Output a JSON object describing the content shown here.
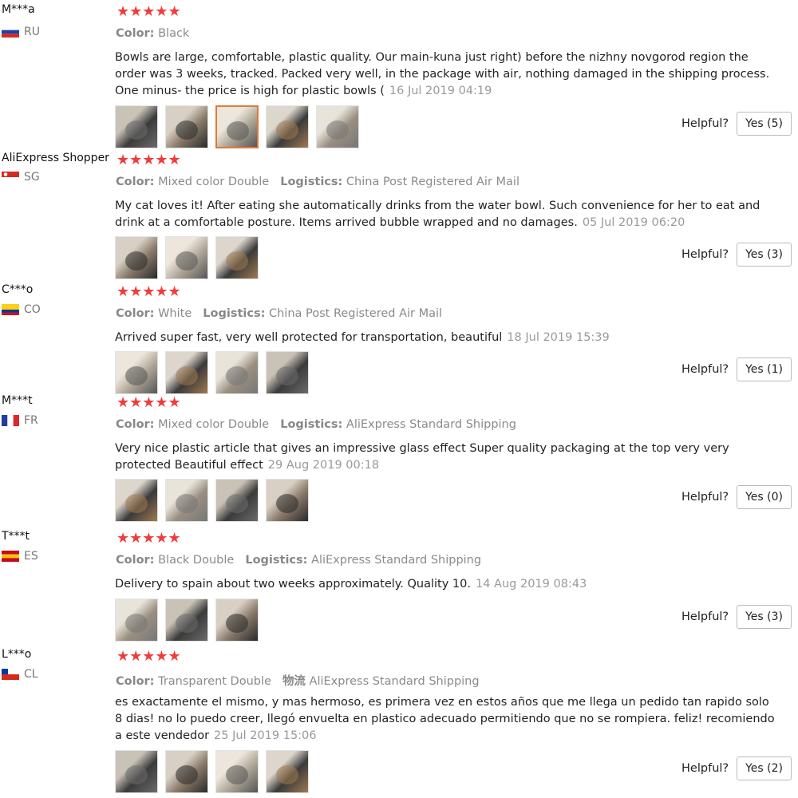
{
  "reviews": [
    {
      "user": "M***a",
      "country": "RU",
      "flag": [
        "#ffffff",
        "#1c3fa8",
        "#d52b1e"
      ],
      "stars": "★★★★★",
      "meta": [
        {
          "k": "Color:",
          "v": "Black"
        }
      ],
      "text": "Bowls are large, comfortable, plastic quality. Our main-kuna just right) before the nizhny novgorod region the order was 3 weeks, tracked. Packed very well, in the package with air, nothing damaged in the shipping process. One minus- the price is high for plastic bowls (",
      "date": "16 Jul 2019 04:19",
      "photos": [
        "photo-1",
        "photo-2",
        "photo-3",
        "photo-4",
        "photo-5"
      ],
      "helpful_label": "Helpful?",
      "yes_label": "Yes (5)"
    },
    {
      "user": "AliExpress Shopper",
      "country": "SG",
      "flag": [
        "#d52b1e",
        "#ffffff"
      ],
      "stars": "★★★★★",
      "meta": [
        {
          "k": "Color:",
          "v": "Mixed color Double"
        },
        {
          "k": "Logistics:",
          "v": "China Post Registered Air Mail"
        }
      ],
      "text": "My cat loves it! After eating she automatically drinks from the water bowl. Such convenience for her to eat and drink at a comfortable posture. Items arrived bubble wrapped and no damages.",
      "date": "05 Jul 2019 06:20",
      "photos": [
        "photo-1",
        "photo-2",
        "photo-3"
      ],
      "helpful_label": "Helpful?",
      "yes_label": "Yes (3)"
    },
    {
      "user": "C***o",
      "country": "CO",
      "flag": [
        "#fcd116",
        "#003893",
        "#ce1126"
      ],
      "stars": "★★★★★",
      "meta": [
        {
          "k": "Color:",
          "v": "White"
        },
        {
          "k": "Logistics:",
          "v": "China Post Registered Air Mail"
        }
      ],
      "text": "Arrived super fast, very well protected for transportation, beautiful",
      "date": "18 Jul 2019 15:39",
      "photos": [
        "photo-1",
        "photo-2",
        "photo-3",
        "photo-4"
      ],
      "helpful_label": "Helpful?",
      "yes_label": "Yes (1)"
    },
    {
      "user": "M***t",
      "country": "FR",
      "flag": [
        "#1f3fa0",
        "#ffffff",
        "#e1252b"
      ],
      "stars": "★★★★★",
      "meta": [
        {
          "k": "Color:",
          "v": "Mixed color Double"
        },
        {
          "k": "Logistics:",
          "v": "AliExpress Standard Shipping"
        }
      ],
      "text": "Very nice plastic article that gives an impressive glass effect Super quality packaging at the top very very protected Beautiful effect",
      "date": "29 Aug 2019 00:18",
      "photos": [
        "photo-1",
        "photo-2",
        "photo-3",
        "photo-4"
      ],
      "helpful_label": "Helpful?",
      "yes_label": "Yes (0)"
    },
    {
      "user": "T***t",
      "country": "ES",
      "flag": [
        "#c60b1e",
        "#ffc400",
        "#c60b1e"
      ],
      "stars": "★★★★★",
      "meta": [
        {
          "k": "Color:",
          "v": "Black Double"
        },
        {
          "k": "Logistics:",
          "v": "AliExpress Standard Shipping"
        }
      ],
      "text": "Delivery to spain about two weeks approximately. Quality 10.",
      "date": "14 Aug 2019 08:43",
      "photos": [
        "photo-1",
        "photo-2",
        "photo-3"
      ],
      "helpful_label": "Helpful?",
      "yes_label": "Yes (3)"
    },
    {
      "user": "L***o",
      "country": "CL",
      "flag": [
        "#ffffff",
        "#d52b1e"
      ],
      "stars": "★★★★★",
      "meta": [
        {
          "k": "Color:",
          "v": "Transparent Double"
        },
        {
          "k": "物流",
          "v": "AliExpress Standard Shipping"
        }
      ],
      "text": "es exactamente el mismo, y mas hermoso, es primera vez en estos años que me llega un pedido tan rapido solo 8 dias! no lo puedo creer, llegó envuelta en plastico adecuado permitiendo que no se rompiera. feliz! recomiendo a este vendedor",
      "date": "25 Jul 2019 15:06",
      "photos": [
        "photo-1",
        "photo-2",
        "photo-3",
        "photo-4"
      ],
      "helpful_label": "Helpful?",
      "yes_label": "Yes (2)"
    }
  ]
}
